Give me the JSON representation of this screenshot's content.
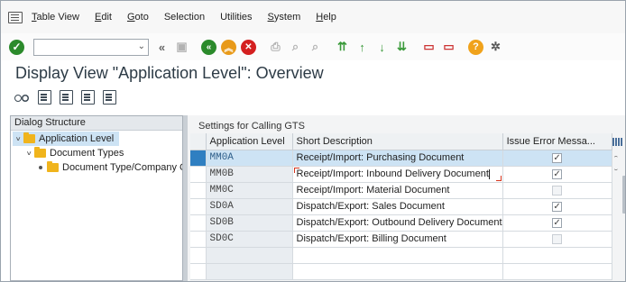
{
  "menu": {
    "items": [
      {
        "u": "T",
        "rest": "able View"
      },
      {
        "u": "E",
        "rest": "dit"
      },
      {
        "u": "G",
        "rest": "oto"
      },
      {
        "u": "",
        "rest": "Selection"
      },
      {
        "u": "",
        "rest": "Utilities"
      },
      {
        "u": "S",
        "rest": "ystem"
      },
      {
        "u": "H",
        "rest": "elp"
      }
    ]
  },
  "toolbar": {
    "command_value": "",
    "help_glyph": "?"
  },
  "page": {
    "title": "Display View \"Application Level\": Overview"
  },
  "dialog_structure": {
    "header": "Dialog Structure",
    "nodes": [
      {
        "label": "Application Level",
        "selected": true
      },
      {
        "label": "Document Types",
        "selected": false
      },
      {
        "label": "Document Type/Company Co",
        "selected": false
      }
    ]
  },
  "settings": {
    "panel_title": "Settings for Calling GTS",
    "columns": [
      "Application Level",
      "Short Description",
      "Issue Error Messa..."
    ],
    "rows": [
      {
        "level": "MM0A",
        "description": "Receipt/Import: Purchasing Document",
        "issue_error": true,
        "editable": true,
        "selected": true
      },
      {
        "level": "MM0B",
        "description": "Receipt/Import: Inbound Delivery Document",
        "issue_error": true,
        "editable": true,
        "selected": false
      },
      {
        "level": "MM0C",
        "description": "Receipt/Import: Material Document",
        "issue_error": false,
        "editable": false,
        "selected": false
      },
      {
        "level": "SD0A",
        "description": "Dispatch/Export: Sales Document",
        "issue_error": true,
        "editable": true,
        "selected": false
      },
      {
        "level": "SD0B",
        "description": "Dispatch/Export: Outbound Delivery Document",
        "issue_error": true,
        "editable": true,
        "selected": false
      },
      {
        "level": "SD0C",
        "description": "Dispatch/Export: Billing Document",
        "issue_error": false,
        "editable": false,
        "selected": false
      }
    ],
    "check_glyph": "✓"
  },
  "colors": {
    "accent": "#2f7fc1",
    "selection": "#cde3f4",
    "title": "#2d3b46"
  }
}
